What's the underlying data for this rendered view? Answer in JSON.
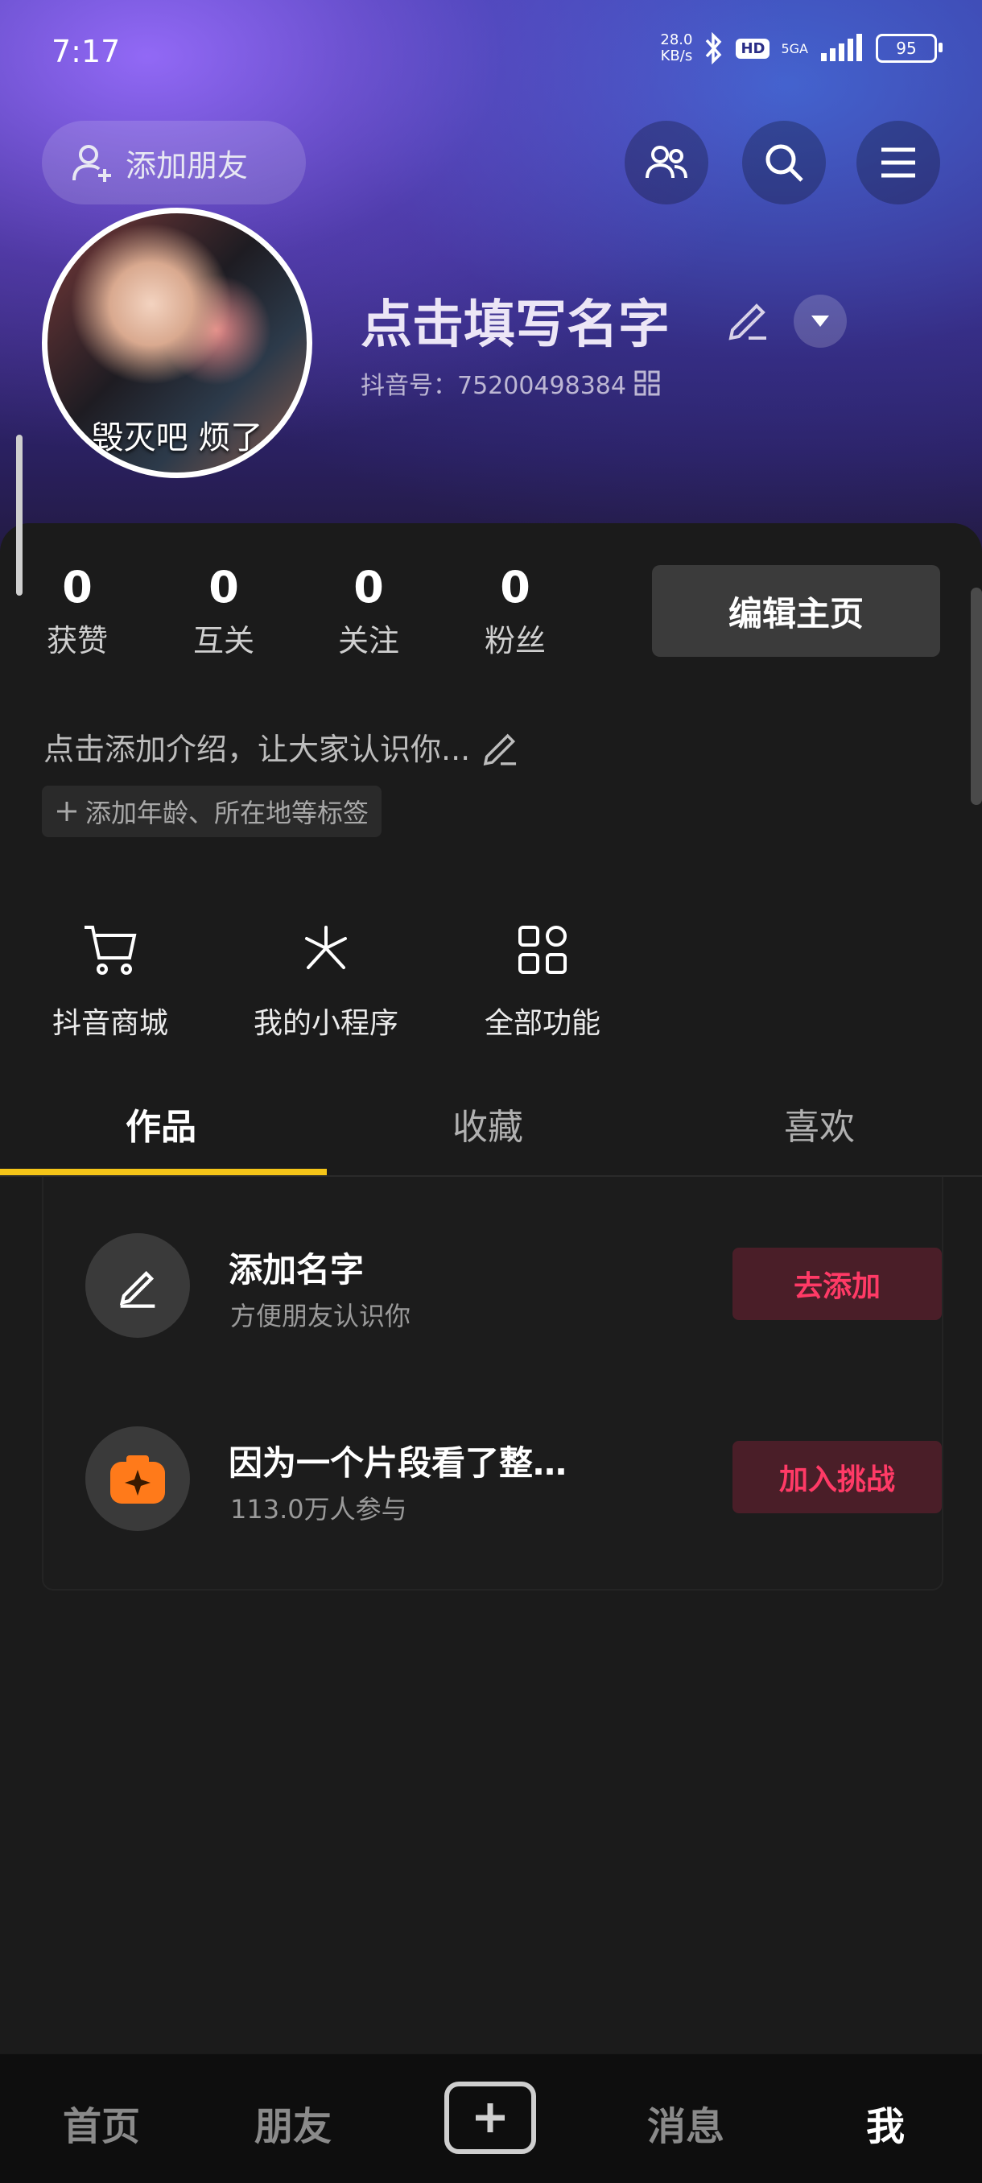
{
  "status_bar": {
    "time": "7:17",
    "net_speed_value": "28.0",
    "net_speed_unit": "KB/s",
    "hd": "HD",
    "network": "5GA",
    "battery": "95"
  },
  "header": {
    "add_friend_label": "添加朋友",
    "avatar_caption": "毁灭吧 烦了",
    "name": "点击填写名字",
    "douyin_id": "抖音号：75200498384"
  },
  "stats": [
    {
      "value": "0",
      "label": "获赞"
    },
    {
      "value": "0",
      "label": "互关"
    },
    {
      "value": "0",
      "label": "关注"
    },
    {
      "value": "0",
      "label": "粉丝"
    }
  ],
  "edit_home_label": "编辑主页",
  "bio_placeholder": "点击添加介绍，让大家认识你...",
  "tag_hint": "添加年龄、所在地等标签",
  "quick_actions": [
    {
      "label": "抖音商城",
      "icon": "cart-icon"
    },
    {
      "label": "我的小程序",
      "icon": "miniapp-icon"
    },
    {
      "label": "全部功能",
      "icon": "grid-icon"
    }
  ],
  "tabs": [
    {
      "label": "作品",
      "active": true
    },
    {
      "label": "收藏",
      "active": false
    },
    {
      "label": "喜欢",
      "active": false
    }
  ],
  "task_rows": [
    {
      "title": "添加名字",
      "subtitle": "方便朋友认识你",
      "button": "去添加"
    },
    {
      "title": "因为一个片段看了整…",
      "subtitle": "113.0万人参与",
      "button": "加入挑战"
    }
  ],
  "bottom_nav": [
    {
      "label": "首页"
    },
    {
      "label": "朋友"
    },
    {
      "label": "消息"
    },
    {
      "label": "我"
    }
  ],
  "colors": {
    "accent_yellow": "#f5c518",
    "cta_red": "#ff3a66",
    "cta_bg": "#4a1e28",
    "panel_bg": "#1b1b1b"
  }
}
